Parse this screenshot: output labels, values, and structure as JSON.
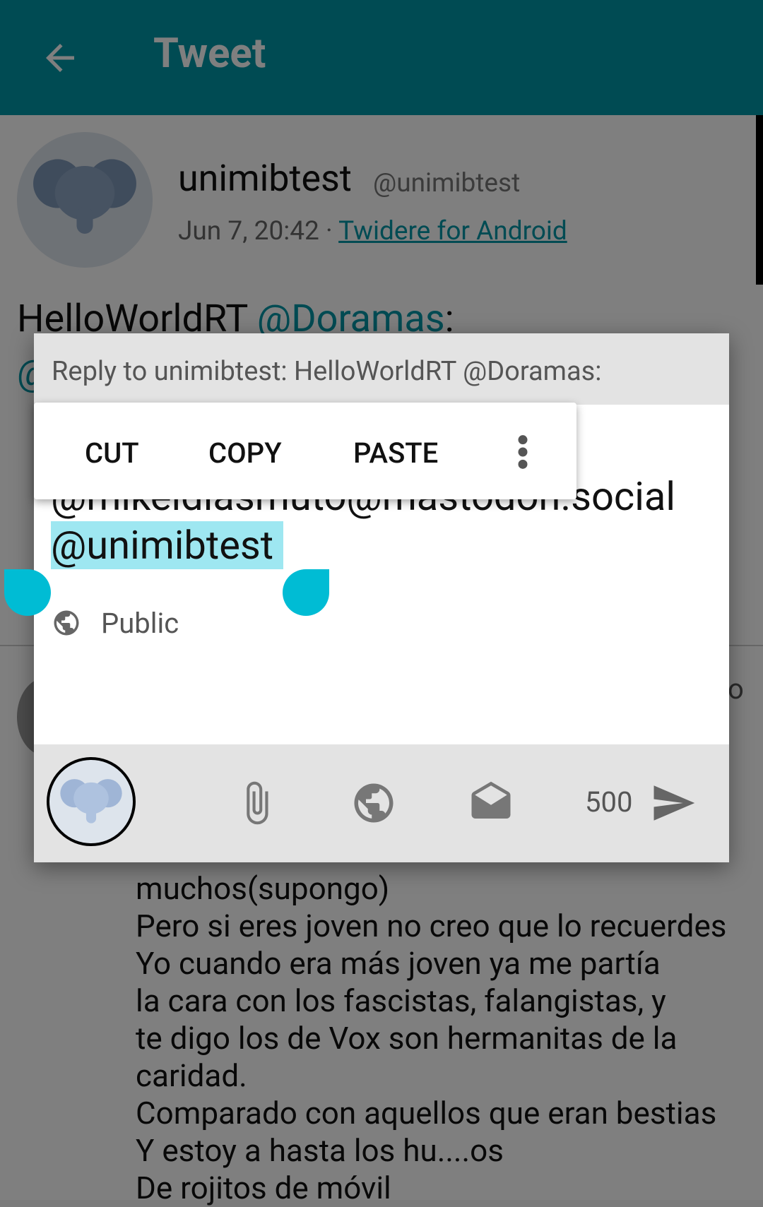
{
  "appbar": {
    "title": "Tweet"
  },
  "status": {
    "username": "unimibtest",
    "handle": "@unimibtest",
    "time": "Jun 7, 20:42 · ",
    "source": "Twidere for Android",
    "text_prefix": "HelloWorldRT ",
    "text_mention": "@Doramas",
    "text_suffix": ":",
    "partial_mention": "@"
  },
  "reply_preview_lines": [
    "muchos(supongo)",
    "Pero si eres joven no creo que lo recuerdes",
    "Yo cuando era más joven ya me partía",
    "la cara con los fascistas, falangistas, y",
    "te digo los de Vox son hermanitas de la",
    "caridad.",
    "Comparado con aquellos que eran bestias",
    "Y estoy a hasta los hu....os",
    "De rojitos de móvil"
  ],
  "dialog": {
    "header": "Reply to unimibtest: HelloWorldRT @Doramas:",
    "line1": "@mikeldiasmuto@mastodon.social",
    "line2_selected": "@unimibtest",
    "visibility_label": "Public",
    "char_counter": "500"
  },
  "selection_toolbar": {
    "cut": "CUT",
    "copy": "COPY",
    "paste": "PASTE"
  },
  "icons": {
    "back": "arrow-back-icon",
    "attach": "paperclip-icon",
    "visibility": "globe-icon",
    "mail": "mail-icon",
    "send": "send-icon",
    "more": "more-vertical-icon"
  },
  "colors": {
    "primary": "#0097a7",
    "selection": "#9ee7f1",
    "handle": "#00bcd4"
  }
}
